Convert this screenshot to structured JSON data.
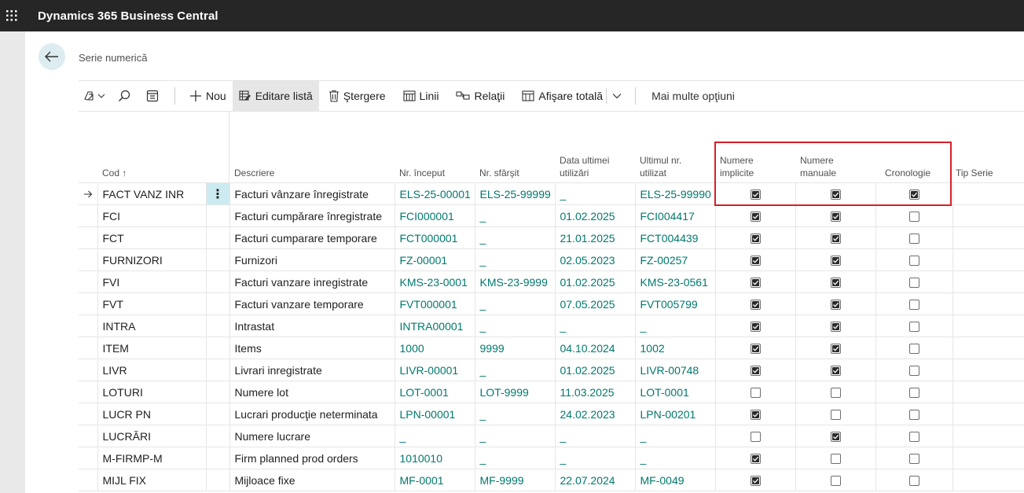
{
  "app": {
    "title": "Dynamics 365 Business Central"
  },
  "page": {
    "title": "Serie numerică"
  },
  "toolbar": {
    "new_label": "Nou",
    "edit_list_label": "Editare listă",
    "delete_label": "Ştergere",
    "lines_label": "Linii",
    "relations_label": "Relaţii",
    "show_all_label": "Afişare totală",
    "more_options_label": "Mai multe opţiuni"
  },
  "columns": {
    "cod": "Cod ↑",
    "descriere": "Descriere",
    "nr_inceput": "Nr. început",
    "nr_sfarsit": "Nr. sfârşit",
    "data_ultimei": [
      "Data ultimei",
      "utilizări"
    ],
    "ultimul_nr": [
      "Ultimul nr.",
      "utilizat"
    ],
    "numere_implicite": [
      "Numere",
      "implicite"
    ],
    "numere_manuale": [
      "Numere",
      "manuale"
    ],
    "cronologie": "Cronologie",
    "tip_serie": "Tip Serie"
  },
  "rows": [
    {
      "cod": "FACT VANZ INR",
      "descriere": "Facturi vânzare înregistrate",
      "start": "ELS-25-00001",
      "end": "ELS-25-99999",
      "date": "_",
      "last": "ELS-25-99990",
      "implicit": true,
      "manual": true,
      "cron": true
    },
    {
      "cod": "FCI",
      "descriere": "Facturi cumpărare înregistrate",
      "start": "FCI000001",
      "end": "_",
      "date": "01.02.2025",
      "last": "FCI004417",
      "implicit": true,
      "manual": true,
      "cron": false
    },
    {
      "cod": "FCT",
      "descriere": "Facturi cumparare temporare",
      "start": "FCT000001",
      "end": "_",
      "date": "21.01.2025",
      "last": "FCT004439",
      "implicit": true,
      "manual": true,
      "cron": false
    },
    {
      "cod": "FURNIZORI",
      "descriere": "Furnizori",
      "start": "FZ-00001",
      "end": "_",
      "date": "02.05.2023",
      "last": "FZ-00257",
      "implicit": true,
      "manual": true,
      "cron": false
    },
    {
      "cod": "FVI",
      "descriere": "Facturi vanzare inregistrate",
      "start": "KMS-23-0001",
      "end": "KMS-23-9999",
      "date": "01.02.2025",
      "last": "KMS-23-0561",
      "implicit": true,
      "manual": true,
      "cron": false
    },
    {
      "cod": "FVT",
      "descriere": "Facturi vanzare temporare",
      "start": "FVT000001",
      "end": "_",
      "date": "07.05.2025",
      "last": "FVT005799",
      "implicit": true,
      "manual": true,
      "cron": false
    },
    {
      "cod": "INTRA",
      "descriere": "Intrastat",
      "start": "INTRA00001",
      "end": "_",
      "date": "_",
      "last": "_",
      "implicit": true,
      "manual": true,
      "cron": false
    },
    {
      "cod": "ITEM",
      "descriere": "Items",
      "start": "1000",
      "end": "9999",
      "date": "04.10.2024",
      "last": "1002",
      "implicit": true,
      "manual": true,
      "cron": false
    },
    {
      "cod": "LIVR",
      "descriere": "Livrari inregistrate",
      "start": "LIVR-00001",
      "end": "_",
      "date": "01.02.2025",
      "last": "LIVR-00748",
      "implicit": true,
      "manual": true,
      "cron": false
    },
    {
      "cod": "LOTURI",
      "descriere": "Numere lot",
      "start": "LOT-0001",
      "end": "LOT-9999",
      "date": "11.03.2025",
      "last": "LOT-0001",
      "implicit": false,
      "manual": false,
      "cron": false
    },
    {
      "cod": "LUCR PN",
      "descriere": "Lucrari producţie neterminata",
      "start": "LPN-00001",
      "end": "_",
      "date": "24.02.2023",
      "last": "LPN-00201",
      "implicit": true,
      "manual": false,
      "cron": false
    },
    {
      "cod": "LUCRĂRI",
      "descriere": "Numere lucrare",
      "start": "_",
      "end": "_",
      "date": "_",
      "last": "_",
      "implicit": false,
      "manual": true,
      "cron": false
    },
    {
      "cod": "M-FIRMP-M",
      "descriere": "Firm planned prod orders",
      "start": "1010010",
      "end": "_",
      "date": "_",
      "last": "_",
      "implicit": true,
      "manual": false,
      "cron": false
    },
    {
      "cod": "MIJL FIX",
      "descriere": "Mijloace fixe",
      "start": "MF-0001",
      "end": "MF-9999",
      "date": "22.07.2024",
      "last": "MF-0049",
      "implicit": true,
      "manual": false,
      "cron": false
    }
  ]
}
